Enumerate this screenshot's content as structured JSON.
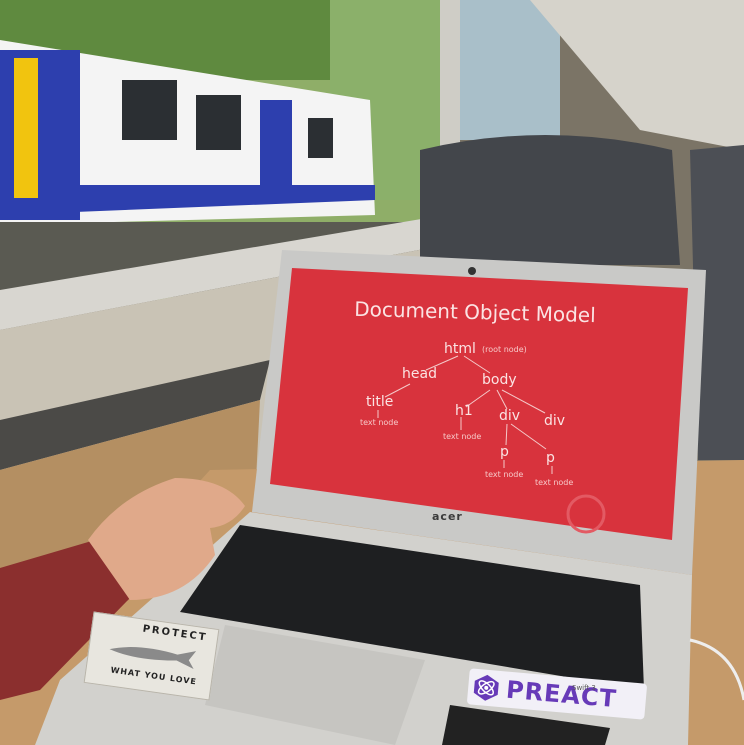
{
  "slide": {
    "title": "Document Object Model",
    "nodes": {
      "html": "html",
      "root_note": "(root node)",
      "head": "head",
      "body": "body",
      "title": "title",
      "h1": "h1",
      "div1": "div",
      "div2": "div",
      "p1": "p",
      "p2": "p"
    },
    "text_node_label": "text node"
  },
  "laptop": {
    "brand": "acer",
    "model": "Swift 3"
  },
  "stickers": {
    "protect_top": "PROTECT",
    "protect_bottom": "WHAT YOU LOVE",
    "preact": "PREACT"
  },
  "colors": {
    "slide_red": "#d8333d",
    "laptop_silver": "#c9c9c7",
    "train_blue": "#2d3fae",
    "preact_purple": "#673ab8"
  }
}
